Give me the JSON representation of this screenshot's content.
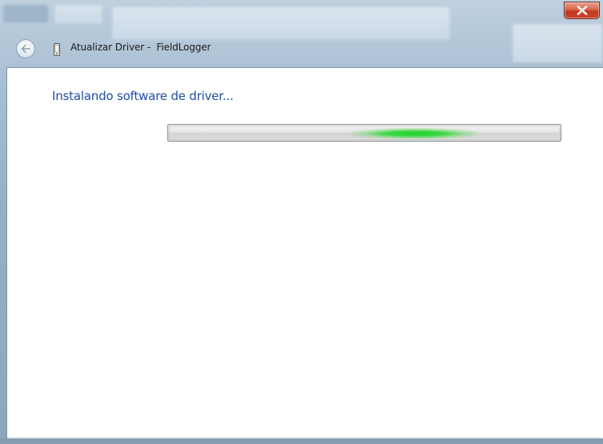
{
  "window": {
    "header_title": "Atualizar Driver -  FieldLogger",
    "close_symbol": "x"
  },
  "content": {
    "heading": "Instalando software de driver..."
  },
  "progress": {
    "state": "indeterminate",
    "glow_color": "#3ad642"
  },
  "icons": {
    "back": "back-arrow-icon",
    "device": "usb-device-icon",
    "close": "close-icon"
  },
  "colors": {
    "heading": "#1e4fa8",
    "close_button": "#c9452b"
  }
}
